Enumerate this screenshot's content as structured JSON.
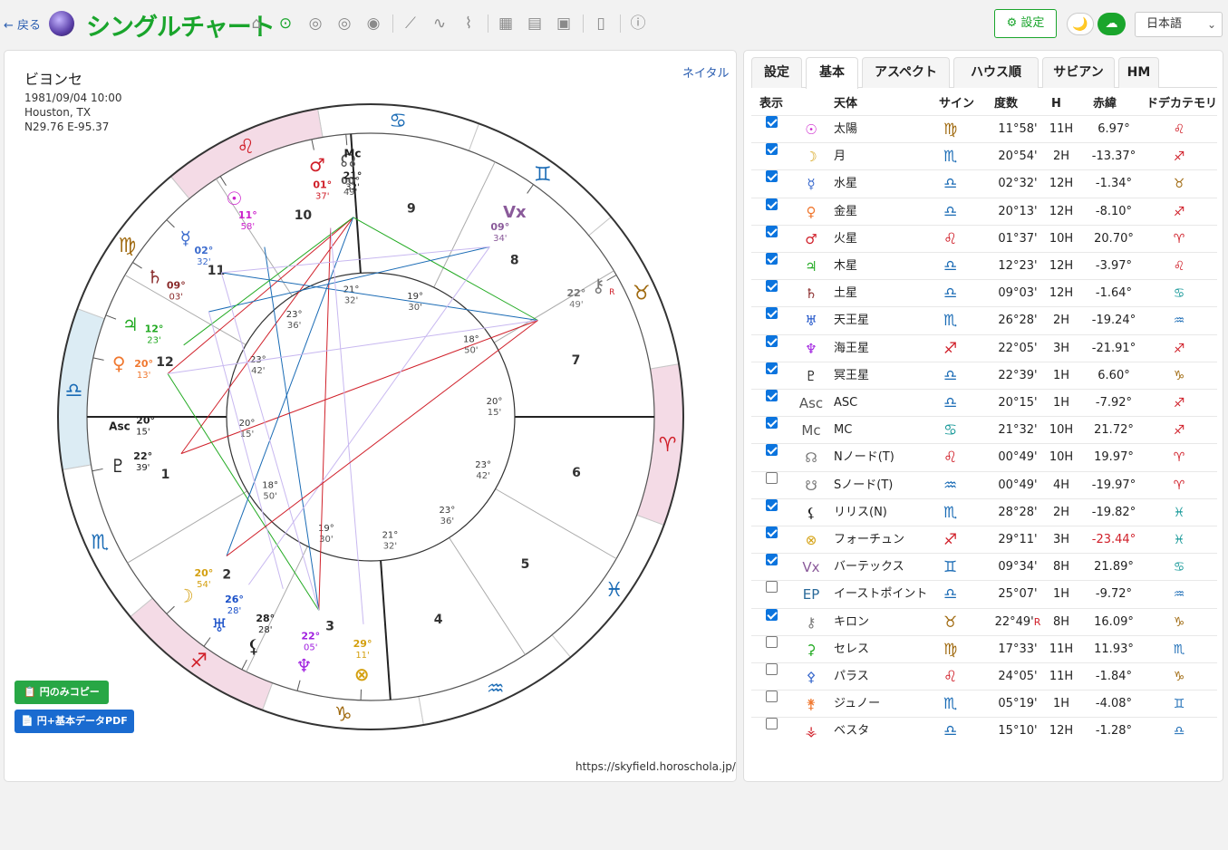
{
  "topbar": {
    "back_label": "← 戻る",
    "title": "シングルチャート",
    "icons": [
      "home-icon",
      "target-icon",
      "circle2-icon",
      "circle3-icon",
      "circle4-icon",
      "line-chart-icon",
      "wave-icon",
      "zigzag-icon",
      "grid-icon",
      "calendar-icon",
      "calendar-plus-icon",
      "clipboard-icon",
      "help-icon"
    ],
    "settings_label": "⚙ 設定",
    "moon_glyph": "🌙",
    "cloud_glyph": "☁",
    "language": "日本語"
  },
  "left": {
    "name": "ビヨンセ",
    "datetime": "1981/09/04 10:00",
    "place": "Houston, TX",
    "coords": "N29.76 E-95.37",
    "natal_link": "ネイタル",
    "copy_button": "📋 円のみコピー",
    "pdf_button": "📄 円+基本データPDF",
    "url": "https://skyfield.horoschola.jp/"
  },
  "chart": {
    "signs_ccw_from_asc": [
      {
        "glyph": "♎",
        "color": "#1a6bb5"
      },
      {
        "glyph": "♏",
        "color": "#1a6bb5"
      },
      {
        "glyph": "♐",
        "color": "#d0202a"
      },
      {
        "glyph": "♑",
        "color": "#a06a10"
      },
      {
        "glyph": "♒",
        "color": "#1a6bb5"
      },
      {
        "glyph": "♓",
        "color": "#1a6bb5"
      },
      {
        "glyph": "♈",
        "color": "#d0202a"
      },
      {
        "glyph": "♉",
        "color": "#a06a10"
      },
      {
        "glyph": "♊",
        "color": "#1a6bb5"
      },
      {
        "glyph": "♋",
        "color": "#1a6bb5"
      },
      {
        "glyph": "♌",
        "color": "#d0202a"
      },
      {
        "glyph": "♍",
        "color": "#a06a10"
      }
    ],
    "house_numbers": [
      "1",
      "2",
      "3",
      "4",
      "5",
      "6",
      "7",
      "8",
      "9",
      "10",
      "11",
      "12"
    ],
    "cusp_labels": [
      {
        "deg": "20°",
        "min": "15'"
      },
      {
        "deg": "18°",
        "min": "50'"
      },
      {
        "deg": "19°",
        "min": "30'"
      },
      {
        "deg": "21°",
        "min": "32'"
      },
      {
        "deg": "23°",
        "min": "36'"
      },
      {
        "deg": "23°",
        "min": "42'"
      },
      {
        "deg": "20°",
        "min": "15'"
      },
      {
        "deg": "18°",
        "min": "50'"
      },
      {
        "deg": "19°",
        "min": "30'"
      },
      {
        "deg": "21°",
        "min": "32'"
      },
      {
        "deg": "23°",
        "min": "36'"
      },
      {
        "deg": "23°",
        "min": "42'"
      }
    ],
    "asc_label": "Asc",
    "mc_label": "Mc",
    "asc_deg": "20°",
    "asc_min": "15'",
    "mc_deg": "21°",
    "mc_min": "32'",
    "planets": [
      {
        "glyph": "♂",
        "color": "#d0202a",
        "deg": "01°",
        "min": "37'"
      },
      {
        "glyph": "☊",
        "color": "#555555",
        "deg": "00°",
        "min": "49'"
      },
      {
        "glyph": "Vx",
        "color": "#8a5a9a",
        "deg": "09°",
        "min": "34'"
      },
      {
        "glyph": "⚷",
        "color": "#777777",
        "deg": "22°",
        "min": "49'",
        "retro": "R"
      },
      {
        "glyph": "☉",
        "color": "#cc22cc",
        "deg": "11°",
        "min": "58'"
      },
      {
        "glyph": "☿",
        "color": "#3a6acd",
        "deg": "02°",
        "min": "32'"
      },
      {
        "glyph": "♄",
        "color": "#8a2a2a",
        "deg": "09°",
        "min": "03'"
      },
      {
        "glyph": "♃",
        "color": "#22aa22",
        "deg": "12°",
        "min": "23'"
      },
      {
        "glyph": "♀",
        "color": "#f07830",
        "deg": "20°",
        "min": "13'"
      },
      {
        "glyph": "♇",
        "color": "#222222",
        "deg": "22°",
        "min": "39'"
      },
      {
        "glyph": "☽",
        "color": "#d4a010",
        "deg": "20°",
        "min": "54'"
      },
      {
        "glyph": "♅",
        "color": "#1a50c8",
        "deg": "26°",
        "min": "28'"
      },
      {
        "glyph": "⚸",
        "color": "#222222",
        "deg": "28°",
        "min": "28'"
      },
      {
        "glyph": "♆",
        "color": "#a020e0",
        "deg": "22°",
        "min": "05'"
      },
      {
        "glyph": "⊗",
        "color": "#d4a010",
        "deg": "29°",
        "min": "11'"
      }
    ]
  },
  "right": {
    "tabs": [
      "設定",
      "基本",
      "アスペクト",
      "ハウス順",
      "サビアン",
      "HM"
    ],
    "headers": [
      "表示",
      "天体",
      "サイン",
      "度数",
      "H",
      "赤緯",
      "ドデカテモリ"
    ],
    "rows": [
      {
        "on": true,
        "icon": "☉",
        "icon_color": "#cc22cc",
        "name": "太陽",
        "sign": "♍",
        "sign_color": "#a06a10",
        "deg": "11°58'",
        "house": "11H",
        "decl": "6.97°",
        "dode": "♌",
        "dode_color": "#d0202a"
      },
      {
        "on": true,
        "icon": "☽",
        "icon_color": "#d4a010",
        "name": "月",
        "sign": "♏",
        "sign_color": "#1a6bb5",
        "deg": "20°54'",
        "house": "2H",
        "decl": "-13.37°",
        "dode": "♐",
        "dode_color": "#d0202a"
      },
      {
        "on": true,
        "icon": "☿",
        "icon_color": "#3a6acd",
        "name": "水星",
        "sign": "♎",
        "sign_color": "#1a6bb5",
        "deg": "02°32'",
        "house": "12H",
        "decl": "-1.34°",
        "dode": "♉",
        "dode_color": "#a06a10"
      },
      {
        "on": true,
        "icon": "♀",
        "icon_color": "#f07830",
        "name": "金星",
        "sign": "♎",
        "sign_color": "#1a6bb5",
        "deg": "20°13'",
        "house": "12H",
        "decl": "-8.10°",
        "dode": "♐",
        "dode_color": "#d0202a"
      },
      {
        "on": true,
        "icon": "♂",
        "icon_color": "#d0202a",
        "name": "火星",
        "sign": "♌",
        "sign_color": "#d0202a",
        "deg": "01°37'",
        "house": "10H",
        "decl": "20.70°",
        "dode": "♈",
        "dode_color": "#d0202a"
      },
      {
        "on": true,
        "icon": "♃",
        "icon_color": "#22aa22",
        "name": "木星",
        "sign": "♎",
        "sign_color": "#1a6bb5",
        "deg": "12°23'",
        "house": "12H",
        "decl": "-3.97°",
        "dode": "♌",
        "dode_color": "#d0202a"
      },
      {
        "on": true,
        "icon": "♄",
        "icon_color": "#8a2a2a",
        "name": "土星",
        "sign": "♎",
        "sign_color": "#1a6bb5",
        "deg": "09°03'",
        "house": "12H",
        "decl": "-1.64°",
        "dode": "♋",
        "dode_color": "#1a9a9a"
      },
      {
        "on": true,
        "icon": "♅",
        "icon_color": "#1a50c8",
        "name": "天王星",
        "sign": "♏",
        "sign_color": "#1a6bb5",
        "deg": "26°28'",
        "house": "2H",
        "decl": "-19.24°",
        "dode": "♒",
        "dode_color": "#1a6bb5"
      },
      {
        "on": true,
        "icon": "♆",
        "icon_color": "#a020e0",
        "name": "海王星",
        "sign": "♐",
        "sign_color": "#d0202a",
        "deg": "22°05'",
        "house": "3H",
        "decl": "-21.91°",
        "dode": "♐",
        "dode_color": "#d0202a"
      },
      {
        "on": true,
        "icon": "♇",
        "icon_color": "#222222",
        "name": "冥王星",
        "sign": "♎",
        "sign_color": "#1a6bb5",
        "deg": "22°39'",
        "house": "1H",
        "decl": "6.60°",
        "dode": "♑",
        "dode_color": "#a06a10"
      },
      {
        "on": true,
        "icon": "Asc",
        "icon_color": "#555555",
        "name": "ASC",
        "sign": "♎",
        "sign_color": "#1a6bb5",
        "deg": "20°15'",
        "house": "1H",
        "decl": "-7.92°",
        "dode": "♐",
        "dode_color": "#d0202a"
      },
      {
        "on": true,
        "icon": "Mc",
        "icon_color": "#555555",
        "name": "MC",
        "sign": "♋",
        "sign_color": "#1a9a9a",
        "deg": "21°32'",
        "house": "10H",
        "decl": "21.72°",
        "dode": "♐",
        "dode_color": "#d0202a"
      },
      {
        "on": true,
        "icon": "☊",
        "icon_color": "#777777",
        "name": "Nノード(T)",
        "sign": "♌",
        "sign_color": "#d0202a",
        "deg": "00°49'",
        "house": "10H",
        "decl": "19.97°",
        "dode": "♈",
        "dode_color": "#d0202a"
      },
      {
        "on": false,
        "icon": "☋",
        "icon_color": "#777777",
        "name": "Sノード(T)",
        "sign": "♒",
        "sign_color": "#1a6bb5",
        "deg": "00°49'",
        "house": "4H",
        "decl": "-19.97°",
        "dode": "♈",
        "dode_color": "#d0202a"
      },
      {
        "on": true,
        "icon": "⚸",
        "icon_color": "#222222",
        "name": "リリス(N)",
        "sign": "♏",
        "sign_color": "#1a6bb5",
        "deg": "28°28'",
        "house": "2H",
        "decl": "-19.82°",
        "dode": "♓",
        "dode_color": "#1a9a9a"
      },
      {
        "on": true,
        "icon": "⊗",
        "icon_color": "#d4a010",
        "name": "フォーチュン",
        "sign": "♐",
        "sign_color": "#d0202a",
        "deg": "29°11'",
        "house": "3H",
        "decl": "-23.44°",
        "decl_color": "#d0202a",
        "dode": "♓",
        "dode_color": "#1a9a9a"
      },
      {
        "on": true,
        "icon": "Vx",
        "icon_color": "#8a5a9a",
        "name": "バーテックス",
        "sign": "♊",
        "sign_color": "#1a6bb5",
        "deg": "09°34'",
        "house": "8H",
        "decl": "21.89°",
        "dode": "♋",
        "dode_color": "#1a9a9a"
      },
      {
        "on": false,
        "icon": "EP",
        "icon_color": "#2a6a9a",
        "name": "イーストポイント",
        "sign": "♎",
        "sign_color": "#1a6bb5",
        "deg": "25°07'",
        "house": "1H",
        "decl": "-9.72°",
        "dode": "♒",
        "dode_color": "#1a6bb5"
      },
      {
        "on": true,
        "icon": "⚷",
        "icon_color": "#777777",
        "name": "キロン",
        "sign": "♉",
        "sign_color": "#a06a10",
        "deg": "22°49'",
        "retro": "R",
        "house": "8H",
        "decl": "16.09°",
        "dode": "♑",
        "dode_color": "#a06a10"
      },
      {
        "on": false,
        "icon": "⚳",
        "icon_color": "#22aa22",
        "name": "セレス",
        "sign": "♍",
        "sign_color": "#a06a10",
        "deg": "17°33'",
        "house": "11H",
        "decl": "11.93°",
        "dode": "♏",
        "dode_color": "#1a6bb5"
      },
      {
        "on": false,
        "icon": "⚴",
        "icon_color": "#3a6acd",
        "name": "パラス",
        "sign": "♌",
        "sign_color": "#d0202a",
        "deg": "24°05'",
        "house": "11H",
        "decl": "-1.84°",
        "dode": "♑",
        "dode_color": "#a06a10"
      },
      {
        "on": false,
        "icon": "⚵",
        "icon_color": "#f07830",
        "name": "ジュノー",
        "sign": "♏",
        "sign_color": "#1a6bb5",
        "deg": "05°19'",
        "house": "1H",
        "decl": "-4.08°",
        "dode": "♊",
        "dode_color": "#1a6bb5"
      },
      {
        "on": false,
        "icon": "⚶",
        "icon_color": "#d0202a",
        "name": "ベスタ",
        "sign": "♎",
        "sign_color": "#1a6bb5",
        "deg": "15°10'",
        "house": "12H",
        "decl": "-1.28°",
        "dode": "♎",
        "dode_color": "#1a6bb5"
      }
    ]
  }
}
